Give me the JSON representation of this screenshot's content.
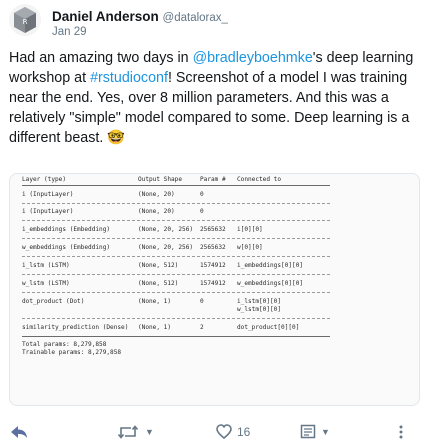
{
  "author": {
    "name": "Daniel Anderson",
    "handle": "@datalorax_",
    "date": "Jan 29"
  },
  "tweet": {
    "part1": "Had an amazing two days in ",
    "mention": "@bradleyboehmke",
    "part2": "'s deep learning workshop at ",
    "hashtag": "#rstudioconf",
    "part3": "! Screenshot of a model I was training near the end. Yes, over 8 million parameters. And this was a relatively \"simple\" model compared to some. Deep learning is a different beast. ",
    "emoji": "🤓"
  },
  "summary": {
    "headers": [
      "Layer (type)",
      "Output Shape",
      "Param #",
      "Connected to"
    ],
    "rows": [
      {
        "layer": "i (InputLayer)",
        "shape": "(None, 20)",
        "params": "0",
        "connected": []
      },
      {
        "layer": "i (InputLayer)",
        "shape": "(None, 20)",
        "params": "0",
        "connected": []
      },
      {
        "layer": "i_embeddings (Embedding)",
        "shape": "(None, 20, 256)",
        "params": "2565632",
        "connected": [
          "i[0][0]"
        ]
      },
      {
        "layer": "w_embeddings (Embedding)",
        "shape": "(None, 20, 256)",
        "params": "2565632",
        "connected": [
          "w[0][0]"
        ]
      },
      {
        "layer": "i_lstm (LSTM)",
        "shape": "(None, 512)",
        "params": "1574912",
        "connected": [
          "i_embeddings[0][0]"
        ]
      },
      {
        "layer": "w_lstm (LSTM)",
        "shape": "(None, 512)",
        "params": "1574912",
        "connected": [
          "w_embeddings[0][0]"
        ]
      },
      {
        "layer": "dot_product (Dot)",
        "shape": "(None, 1)",
        "params": "0",
        "connected": [
          "i_lstm[0][0]",
          "w_lstm[0][0]"
        ]
      },
      {
        "layer": "similarity_prediction (Dense)",
        "shape": "(None, 1)",
        "params": "2",
        "connected": [
          "dot_product[0][0]"
        ]
      }
    ],
    "total": "Total params: 8,279,858",
    "trainable": "Trainable params: 8,279,858"
  },
  "actions": {
    "retweets": "",
    "likes": "16",
    "colors": {
      "muted": "#657786",
      "reply": "#5b6fa0"
    }
  },
  "icons": [
    "avatar-icon",
    "reply-icon",
    "retweet-icon",
    "heart-icon",
    "message-icon",
    "more-icon"
  ]
}
